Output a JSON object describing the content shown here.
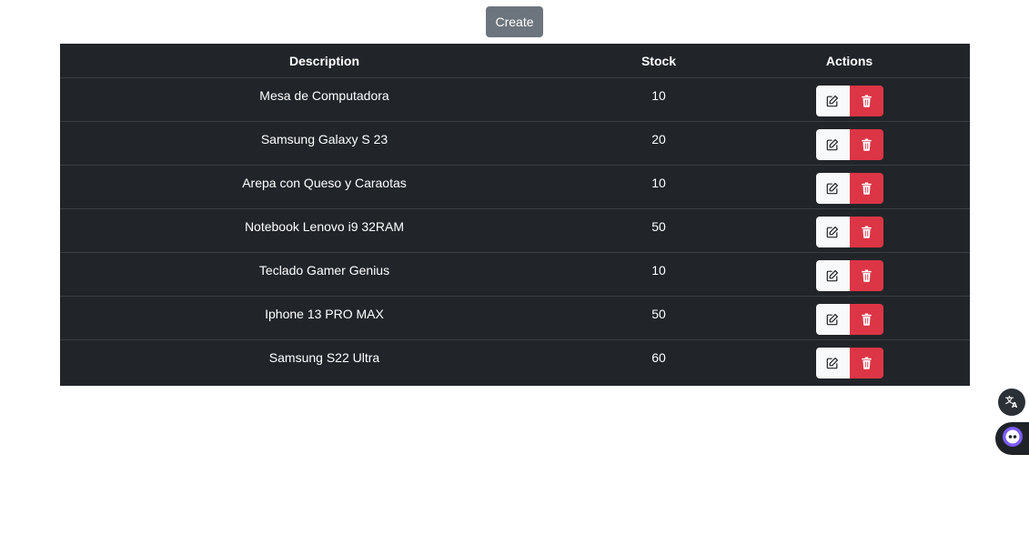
{
  "toolbar": {
    "create_label": "Create"
  },
  "table": {
    "headers": {
      "description": "Description",
      "stock": "Stock",
      "actions": "Actions"
    },
    "rows": [
      {
        "description": "Mesa de Computadora",
        "stock": "10"
      },
      {
        "description": "Samsung Galaxy S 23",
        "stock": "20"
      },
      {
        "description": "Arepa con Queso y Caraotas",
        "stock": "10"
      },
      {
        "description": "Notebook Lenovo i9 32RAM",
        "stock": "50"
      },
      {
        "description": "Teclado Gamer Genius",
        "stock": "10"
      },
      {
        "description": "Iphone 13 PRO MAX",
        "stock": "50"
      },
      {
        "description": "Samsung S22 Ultra",
        "stock": "60"
      }
    ]
  },
  "icons": {
    "edit": "edit-icon",
    "delete": "trash-icon",
    "translate": "translate-icon",
    "assistant": "assistant-icon"
  },
  "colors": {
    "create_button": "#6c757d",
    "table_background": "#212529",
    "edit_button": "#f8f9fa",
    "delete_button": "#dc3545"
  }
}
